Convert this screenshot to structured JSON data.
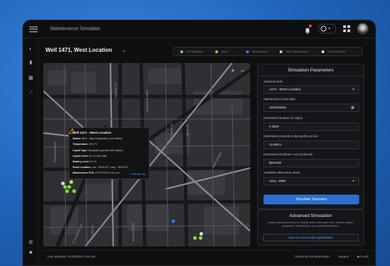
{
  "app": {
    "title": "Maintenance Simulator"
  },
  "well": {
    "title": "Well  1471, West Location"
  },
  "legend": [
    {
      "label": "In Production",
      "color": "#8bdc3a"
    },
    {
      "label": "Alert",
      "color": "#f0a830"
    },
    {
      "label": "Maintenance",
      "color": "#3a7de8"
    },
    {
      "label": "Next Maintenance",
      "color": "#d8d560"
    },
    {
      "label": "Out of Service",
      "color": "#d6d6d6"
    }
  ],
  "map": {
    "zoom_in": "+",
    "zoom_out": "−",
    "street_labels": [
      "NORRIS ST",
      "MARTIN STREET",
      "ANN ST",
      "OLYMPIC ST",
      "HOPE ST",
      "ADA STREET",
      "LINCOLN BLVD",
      "N JACKSON ST",
      "MAIN STREET",
      "STATE ST"
    ]
  },
  "popup": {
    "title": "Well 1471 - West Location",
    "rows": [
      {
        "label": "Status:",
        "value": " Alert - High temperature, low battery"
      },
      {
        "label": "Temperature:",
        "value": " 93.4 °C"
      },
      {
        "label": "Liquid Type:",
        "value": " Mid-grade gasoline (89 octane)"
      },
      {
        "label": "Liquid Level:",
        "value": " 5.0 % (186 Gal)"
      },
      {
        "label": "Battery Level:",
        "value": " 8.2 %"
      },
      {
        "label": "Exact Location:",
        "value": " Lat: ~36.5123°, Long: ~96.6713°"
      },
      {
        "label": "Maintenance ETA:",
        "value": " 07/27/2025 10:42 a.m."
      }
    ],
    "link": "View tank info"
  },
  "simulation": {
    "title": "Simulation Parameters",
    "selected_tank_label": "Selected tank",
    "selected_tank_value": "1471 - West Location",
    "start_date_label": "Maintenance start date",
    "start_date_value": "10/04/2025",
    "duration_label": "Estimated duration (in days)",
    "duration_value": "4 days",
    "production_label": "Estimated production during this period",
    "production_value": "12.000 L",
    "shutdown_label": "Estimated shutdown cost (optional)",
    "shutdown_value": "$18.000",
    "alt_tanks_label": "Available alternative tanks",
    "alt_tanks_value": "1311, 1699",
    "button": "Simulate Scenario"
  },
  "advanced": {
    "title": "Advanced Simulation",
    "description": "Analyze optimal scenarios for multiple tanks at the same time. Includes supplier assignment, redistribution, and operational efficiency.",
    "button": "View recommended optimization"
  },
  "footer": {
    "updated": "Last updated: 14/03/2026 3:25 pm",
    "docs": "Technical Documentation",
    "support": "Support",
    "brand": "▶ insoft"
  }
}
